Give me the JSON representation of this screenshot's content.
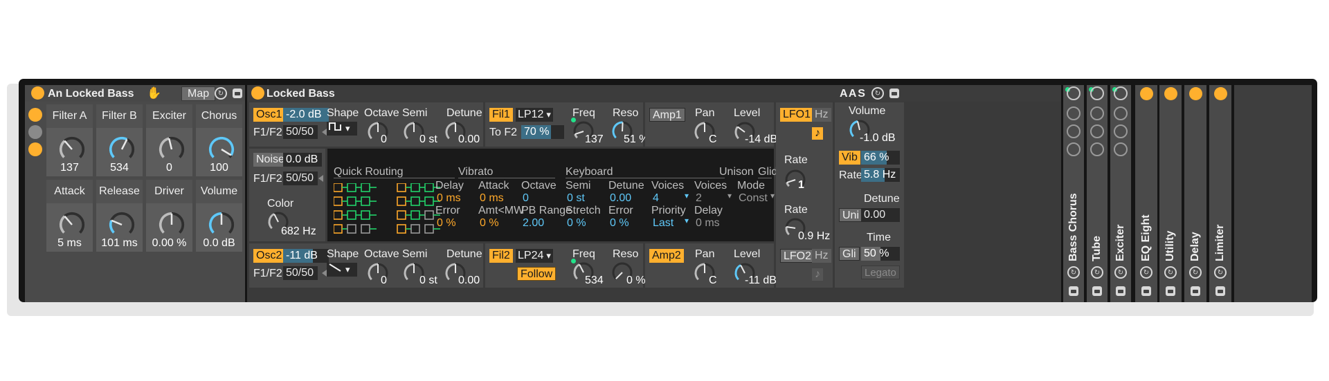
{
  "rack": {
    "title": "An Locked Bass",
    "map_label": "Map",
    "macros": [
      {
        "name": "Filter A",
        "value": "137"
      },
      {
        "name": "Filter B",
        "value": "534"
      },
      {
        "name": "Exciter",
        "value": "0"
      },
      {
        "name": "Chorus",
        "value": "100"
      },
      {
        "name": "Attack",
        "value": "5 ms"
      },
      {
        "name": "Release",
        "value": "101 ms"
      },
      {
        "name": "Driver",
        "value": "0.00 %"
      },
      {
        "name": "Volume",
        "value": "0.0 dB"
      }
    ]
  },
  "synth": {
    "title": "Locked Bass",
    "osc1": {
      "label": "Osc1",
      "level": "-2.0 dB",
      "f1f2_label": "F1/F2",
      "f1f2": "50/50",
      "shape_label": "Shape",
      "octave_label": "Octave",
      "octave": "0",
      "semi_label": "Semi",
      "semi": "0 st",
      "detune_label": "Detune",
      "detune": "0.00"
    },
    "osc2": {
      "label": "Osc2",
      "level": "-11 dB",
      "f1f2_label": "F1/F2",
      "f1f2": "50/50",
      "shape_label": "Shape",
      "octave_label": "Octave",
      "octave": "0",
      "semi_label": "Semi",
      "semi": "0 st",
      "detune_label": "Detune",
      "detune": "0.00"
    },
    "noise": {
      "label": "Noise",
      "level": "0.0 dB",
      "f1f2_label": "F1/F2",
      "f1f2": "50/50",
      "color_label": "Color",
      "color": "682 Hz"
    },
    "fil1": {
      "label": "Fil1",
      "type": "LP12",
      "to_label": "To F2",
      "to_value": "70 %",
      "to_fill": 0.7,
      "freq_label": "Freq",
      "freq": "137",
      "reso_label": "Reso",
      "reso": "51 %"
    },
    "fil2": {
      "label": "Fil2",
      "type": "LP24",
      "follow": "Follow",
      "freq_label": "Freq",
      "freq": "534",
      "reso_label": "Reso",
      "reso": "0 %"
    },
    "amp1": {
      "label": "Amp1",
      "pan_label": "Pan",
      "pan": "C",
      "level_label": "Level",
      "level": "-14 dB"
    },
    "amp2": {
      "label": "Amp2",
      "pan_label": "Pan",
      "pan": "C",
      "level_label": "Level",
      "level": "-11 dB"
    },
    "lfo1": {
      "label": "LFO1",
      "hz": "Hz",
      "note": "♪",
      "rate_label": "Rate",
      "rate": "1"
    },
    "lfo2": {
      "label": "LFO2",
      "hz": "Hz",
      "note": "♪",
      "rate_label": "Rate",
      "rate": "0.9 Hz"
    },
    "global": {
      "volume_label": "Volume",
      "volume": "-1.0 dB",
      "vib_label": "Vib",
      "vib": "66 %",
      "vib_fill": 0.66,
      "rate_label": "Rate",
      "rate": "5.8 Hz",
      "rate_fill": 0.6,
      "uni_label": "Uni",
      "detune_label": "Detune",
      "detune": "0.00",
      "gli_label": "Gli",
      "time_label": "Time",
      "time": "50 %",
      "time_fill": 0.5,
      "legato": "Legato"
    },
    "display": {
      "quick_routing": "Quick Routing",
      "vibrato": "Vibrato",
      "keyboard": "Keyboard",
      "unison": "Unison",
      "glide": "Glide",
      "row1": [
        {
          "label": "Delay",
          "value": "0 ms"
        },
        {
          "label": "Attack",
          "value": "0 ms"
        },
        {
          "label": "Octave",
          "value": "0"
        },
        {
          "label": "Semi",
          "value": "0 st"
        },
        {
          "label": "Detune",
          "value": "0.00"
        },
        {
          "label": "Voices",
          "value": "4"
        },
        {
          "label": "Voices",
          "value": "2"
        },
        {
          "label": "Mode",
          "value": "Const"
        }
      ],
      "row2": [
        {
          "label": "Error",
          "value": "0 %"
        },
        {
          "label": "Amt<MW",
          "value": "0 %"
        },
        {
          "label": "PB Range",
          "value": "2.00"
        },
        {
          "label": "Stretch",
          "value": "0 %"
        },
        {
          "label": "Error",
          "value": "0 %"
        },
        {
          "label": "Priority",
          "value": "Last"
        },
        {
          "label": "Delay",
          "value": "0 ms"
        }
      ]
    },
    "aas": "A A S"
  },
  "devices": [
    "Bass Chorus",
    "Tube",
    "Exciter",
    "EQ Eight",
    "Utility",
    "Delay",
    "Limiter"
  ],
  "colors": {
    "orange": "#ffb02e",
    "blue": "#5fc8f8",
    "frame": "#151515",
    "panel": "#4a4a4a"
  }
}
